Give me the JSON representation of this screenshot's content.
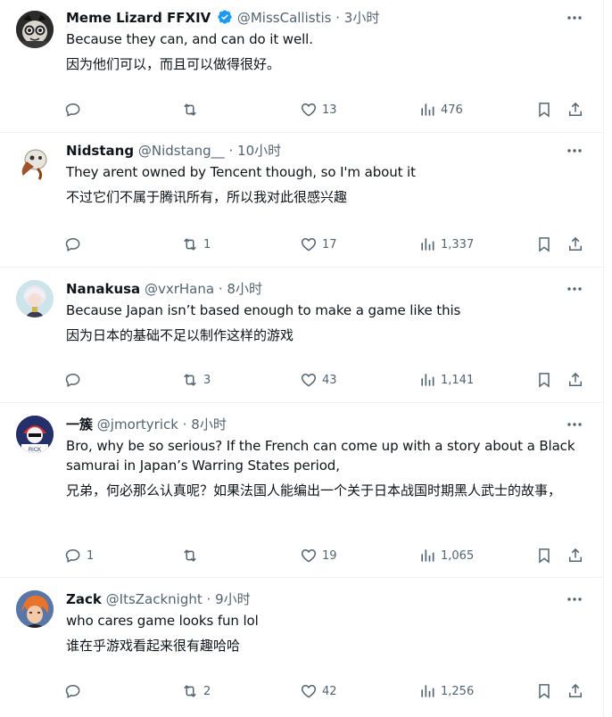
{
  "tweets": [
    {
      "name": "Meme Lizard FFXIV",
      "verified": true,
      "handle": "@MissCallistis",
      "dot": "·",
      "time": "3小时",
      "text": "Because they can, and can do it well.",
      "translation": "因为他们可以，而且可以做得很好。",
      "replies": "",
      "retweets": "",
      "likes": "13",
      "views": "476",
      "avatar_icon": "cat-mask-avatar"
    },
    {
      "name": "Nidstang",
      "verified": false,
      "handle": "@Nidstang__",
      "dot": "·",
      "time": "10小时",
      "text": "They arent owned by Tencent though, so I'm about it",
      "translation": "不过它们不属于腾讯所有，所以我对此很感兴趣",
      "replies": "",
      "retweets": "1",
      "likes": "17",
      "views": "1,337",
      "avatar_icon": "plague-mask-avatar"
    },
    {
      "name": "Nanakusa",
      "verified": false,
      "handle": "@vxrHana",
      "dot": "·",
      "time": "8小时",
      "text": "Because Japan isn’t based enough to make a game like this",
      "translation": "因为日本的基础不足以制作这样的游戏",
      "replies": "",
      "retweets": "3",
      "likes": "43",
      "views": "1,141",
      "avatar_icon": "anime-girl-avatar"
    },
    {
      "name": "一簇",
      "verified": false,
      "handle": "@jmortyrick",
      "dot": "·",
      "time": "8小时",
      "text": "Bro, why be so serious? If the French can come up with a story about a Black samurai in Japan’s Warring States period,",
      "translation": "兄弟，何必那么认真呢？如果法国人能编出一个关于日本战国时期黑人武士的故事，",
      "replies": "1",
      "retweets": "",
      "likes": "19",
      "views": "1,065",
      "avatar_icon": "character-avatar"
    },
    {
      "name": "Zack",
      "verified": false,
      "handle": "@ItsZacknight",
      "dot": "·",
      "time": "9小时",
      "text": "who cares game looks fun lol",
      "translation": "谁在乎游戏看起来很有趣哈哈",
      "replies": "",
      "retweets": "2",
      "likes": "42",
      "views": "1,256",
      "avatar_icon": "orange-hair-avatar"
    }
  ],
  "colors": {
    "text": "#0f1419",
    "secondary": "#536471",
    "verified": "#1d9bf0",
    "border": "#eff3f4"
  }
}
